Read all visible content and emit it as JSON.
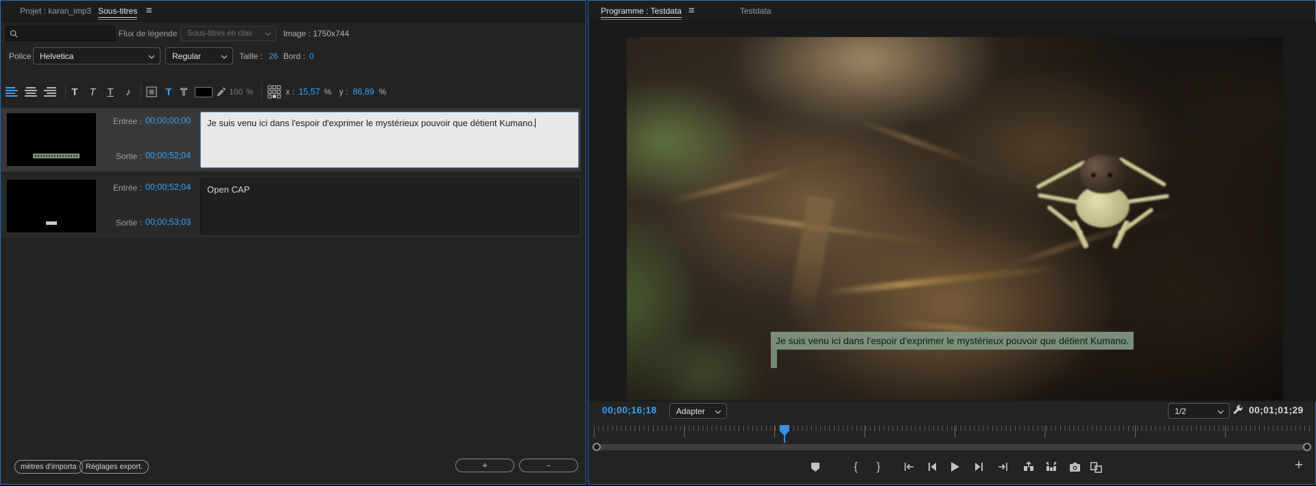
{
  "colors": {
    "accent_blue": "#3ba1f2",
    "panel_border": "#3273bd",
    "subtitle_bg": "#7e9381"
  },
  "left": {
    "tabs": [
      {
        "label": "Projet : karan_imp3",
        "active": false
      },
      {
        "label": "Sous-titres",
        "active": true
      }
    ],
    "menu_icon": "≡",
    "search": {
      "value": "",
      "placeholder": ""
    },
    "stream_label": "Flux de légende :",
    "stream_value": "Sous-titres en clair",
    "image_info": "Image : 1750x744",
    "font": {
      "police_label": "Police :",
      "family": "Helvetica",
      "style": "Regular",
      "taille_label": "Taille :",
      "size": "26",
      "bord_label": "Bord :",
      "edge": "0"
    },
    "toolbar": {
      "bold": "T",
      "italic": "T",
      "underline": "T",
      "music_note": "♪",
      "fill_t": "T",
      "edge_t": "T",
      "opacity": "100",
      "percent": "%",
      "x_label": "x :",
      "x_value": "15,57",
      "y_label": "y :",
      "y_value": "86,89"
    },
    "captions": [
      {
        "in_label": "Entrée :",
        "in_tc": "00;00;00;00",
        "out_label": "Sortie :",
        "out_tc": "00;00;52;04",
        "text": "Je suis venu ici dans l'espoir d'exprimer le mystérieux pouvoir que détient Kumano."
      },
      {
        "in_label": "Entrée :",
        "in_tc": "00;00;52;04",
        "out_label": "Sortie :",
        "out_tc": "00;00;53;03",
        "text": "Open CAP"
      }
    ],
    "footer": {
      "import_button": "mètres d'importa",
      "export_button": "Réglages export.",
      "add_button": "+",
      "remove_button": "-"
    }
  },
  "right": {
    "tabs": [
      {
        "label": "Programme : Testdata",
        "active": true
      },
      {
        "label": "Testdata",
        "active": false
      }
    ],
    "menu_icon": "≡",
    "video": {
      "subtitle": "Je suis venu ici dans l'espoir d'exprimer le mystérieux pouvoir que détient Kumano."
    },
    "controls": {
      "current_time": "00;00;16;18",
      "fit_dropdown": "Adapter",
      "resolution": "1/2",
      "duration": "00;01;01;29"
    },
    "icons": {
      "mark_in": "{",
      "mark_out": "}",
      "add_button": "+"
    }
  }
}
